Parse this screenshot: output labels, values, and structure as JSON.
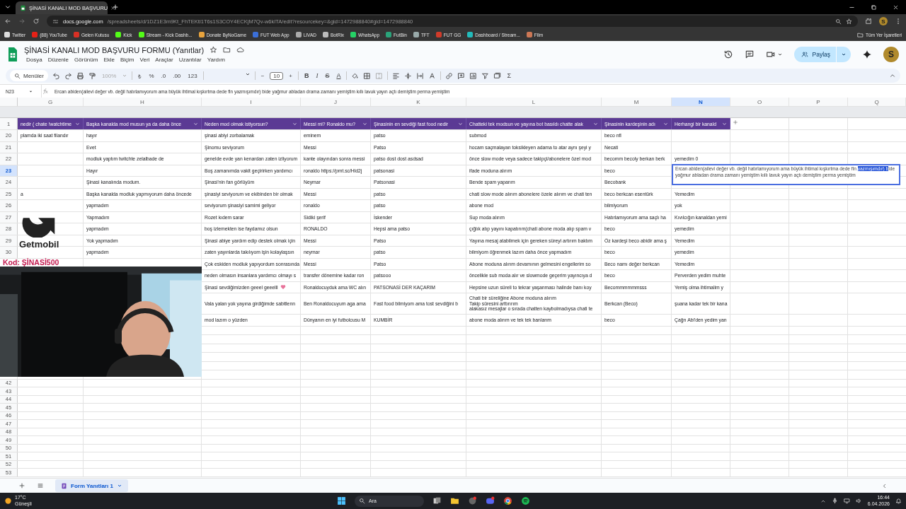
{
  "browser": {
    "tabs": [
      {
        "title": "ŞİNASİ KANALI MOD BAŞVURU",
        "selected": true
      }
    ],
    "url_domain": "docs.google.com",
    "url_path": "/spreadsheets/d/1DZ1E3m9Kt_FhTEKtI1T6s1S3COY4ECKjM7Qv-w6kITA/edit?resourcekey=&gid=1472988840#gid=1472988840",
    "bookmarks": [
      "Twitter",
      "(88) YouTube",
      "Gelen Kutusu",
      "Kick",
      "Stream - Kick Dashb...",
      "Donate ByNoGame",
      "FUT Web App",
      "LIVAD",
      "BotRix",
      "WhatsApp",
      "FutBin",
      "TFT",
      "FUT GG",
      "Dashboard / Stream...",
      "Film"
    ],
    "all_bookmarks": "Tüm Yer İşaretleri",
    "profile_avatar": "S"
  },
  "sheets": {
    "title": "ŞİNASİ KANALI MOD BAŞVURU FORMU (Yanıtlar)",
    "menu": [
      "Dosya",
      "Düzenle",
      "Görünüm",
      "Ekle",
      "Biçim",
      "Veri",
      "Araçlar",
      "Uzantılar",
      "Yardım"
    ],
    "share": "Paylaş",
    "avatar": "S",
    "toolbar": {
      "search": "Menüler",
      "zoom": "100%",
      "zoom_disabled": true,
      "currency": "₺",
      "percent": "%",
      "dec_less": ".0",
      "dec_more": ".00",
      "format": "123",
      "font_minus": "−",
      "font_size": "10",
      "font_plus": "+",
      "bold": "B",
      "italic": "I",
      "strike": "S",
      "text_color": "A",
      "sum": "Σ"
    },
    "name_box": "N23",
    "formula": "Ercan abiden(ailevi değer vb. değil hatırlamıyorum ama büyük ihtimal kışkırtma dede fln yazmışımdır) bide yağmur abladan drama zamanı yemiştim kıllı lavuk yayın açtı demiştim perma yemiştim",
    "columns": [
      {
        "letter": "G",
        "selected": false
      },
      {
        "letter": "H",
        "selected": false
      },
      {
        "letter": "I",
        "selected": false
      },
      {
        "letter": "J",
        "selected": false
      },
      {
        "letter": "K",
        "selected": false
      },
      {
        "letter": "L",
        "selected": false
      },
      {
        "letter": "M",
        "selected": false
      },
      {
        "letter": "N",
        "selected": true
      },
      {
        "letter": "O",
        "selected": false
      },
      {
        "letter": "P",
        "selected": false
      },
      {
        "letter": "Q",
        "selected": false
      }
    ],
    "header_row": {
      "number": "1",
      "cells": [
        "nedir ( chate !watchtime",
        "Başka kanalda mod musun ya da daha önce",
        "Neden mod olmak istiyorsun?",
        "Messi mi? Ronaldo mu?",
        "Şinasinin en sevdiği fast food nedir",
        "Chatteki tek modsun ve yayına bot basıldı chatte alak",
        "Şinasinin kardeşinin adı",
        "Herhangi bir kanald"
      ]
    },
    "rows": [
      {
        "number": "20",
        "selected": false,
        "G": "plamda iki saat filandır",
        "H": "hayır",
        "I": "şinasi abiyi zorbalamak",
        "J": "eminem",
        "K": "patso",
        "L": "submod",
        "M": "beco nfl"
      },
      {
        "number": "21",
        "selected": false,
        "H": "Evet",
        "I": "Şinomu seviyorum",
        "J": "Messi",
        "K": "Patso",
        "L": "hocam saçmalayan toksikleyen adama to atar aynı şeyi y",
        "M": "Necati"
      },
      {
        "number": "22",
        "selected": false,
        "H": "modluk yaptım twitchte zelalbade de",
        "I": "genelde evde yan kenardan zaten izliyorum",
        "J": "kante olayından sonra messi",
        "K": "patso dost dost asdsad",
        "L": "önce slow mode veya sadece takipçi/abonelere özel mod",
        "M": "becomm becoly berkan berk",
        "N": "yemedim 0"
      },
      {
        "number": "23",
        "selected": true,
        "H": "Hayır",
        "I": "Boş zamanımda vakit geçirirken yardımcı",
        "J": "ronaldo https://pmt.sc/Hld2j",
        "K": "patsonasi",
        "L": "ifade moduna alırım",
        "M": "beco"
      },
      {
        "number": "24",
        "selected": false,
        "H": "Şinasi kanalında modum.",
        "I": "Şinasi'nin fan görlüyüm",
        "J": "Neymar",
        "K": "Patsonasi",
        "L": "Bende spam yaparım",
        "M": "Becobank"
      },
      {
        "number": "25",
        "selected": false,
        "G": "a",
        "H": "Başka kanalda modluk yapmıyorum daha öncede",
        "I": "şinasiyi seviyorum ve ekibinden bir olmak",
        "J": "Messi",
        "K": "patso",
        "L": "chati slow mode alırım abonelere özele alırım ve chati ten",
        "M": "beco berkcan esentürk",
        "N": "Yemedim"
      },
      {
        "number": "26",
        "selected": false,
        "H": "yapmadım",
        "I": "seviyorum şinasiyi samimi geliyor",
        "J": "ronaldo",
        "K": "patso",
        "L": "abone mod",
        "M": "bilmiyorum",
        "N": "yok"
      },
      {
        "number": "27",
        "selected": false,
        "H": "Yapmadım",
        "I": "Rozet kıdem sarar",
        "J": "Sidiki şerif",
        "K": "İskender",
        "L": "Sup moda alırım",
        "M": "Hatırlamıyorum ama saçlı ha",
        "N": "Kıvılcığın kanaldan yemi"
      },
      {
        "number": "28",
        "selected": false,
        "H": "yapmadım",
        "I": "boş izlemekten ise faydamız olsun",
        "J": "RONALDO",
        "K": "Hepsi ama patso",
        "L": "çığlık atıp yayını kapatırım(chati abone moda alıp spam v",
        "M": "beco",
        "N": "yemedim"
      },
      {
        "number": "29",
        "selected": false,
        "H": "Yok yapmadım",
        "I": "Şinasi abiye yardım edip destek olmak için",
        "J": "Messi",
        "K": "Patso",
        "L": "Yayına mesaj atabilmek için gereken süreyi artırım baktım",
        "M": "Öz kardeşi beco abidir ama ş",
        "N": "Yemedim"
      },
      {
        "number": "30",
        "selected": false,
        "H": "yapmadım",
        "I": "zaten yayınlarda takılıyom işin kolaylaşsın",
        "J": "neymar",
        "K": "patso",
        "L": "bilmiyom öğrenmek lazım daha önce yapmadım",
        "M": "beco",
        "N": "yemedim"
      },
      {
        "selected": false,
        "I": "Çok eskiden modluk yapıyordum sonrasında",
        "J": "Messi",
        "K": "Patso",
        "L": "Abone moduna alırım devamının gelmesini engellerim so",
        "M": "Beco namı değer berkcan",
        "N": "Yemedim"
      },
      {
        "selected": false,
        "I": "neden olmasın insanlara yardımcı olmayı s",
        "J": "transfer dönemine kadar ron",
        "K": "patsooo",
        "L": "öncelikle sub moda alır ve slowmode geçerim yayıncıya d",
        "M": "beco",
        "N": "Perverden yedim muhte"
      },
      {
        "selected": false,
        "heart": true,
        "I": "Şinasi sevdiğimizden geeel geeelll",
        "J": "Ronaldocuyduk ama WC alın",
        "K": "PATSONASİ DER KAÇARIM",
        "L": "Hepsine uzun süreli to tekrar yaşanması halinde banı koy",
        "M": "Becommmmmmsss",
        "N": "Yemiş olma ihtimalim y"
      },
      {
        "selected": false,
        "tall": true,
        "I": "Vala yalan yok yayına girdiğimde sabitlenn",
        "J": "Ben Ronaldocuyum aga ama",
        "K": "Fast food bilmiyom ama tost sevdiğini b",
        "L": "Chati bir süreliğine Abone moduna alırım\nTakip süresini arttırırım\nalakasız mesajlar o sırada chatten kaybolmadıysa chati te",
        "M": "Berkcan (Beco)",
        "N": "şuana kadar tek bir kana"
      },
      {
        "selected": false,
        "I": "mod lazım o yüzden",
        "J": "Dünyanın en iyi futbolcusu M",
        "K": "KUMBİR",
        "L": "abone moda alırım ve tek tek banlarım",
        "M": "beco",
        "N": "Çağrı Abi'den yedim yan"
      }
    ],
    "editor": {
      "before": "Ercan abiden(ailevi değer vb. değil hatırlamıyorum ama büyük ihtimal kışkırtma dede fln ",
      "highlighted": "yazmışımdır) b",
      "after": "ide yağmur abladan drama zamanı yemiştim kıllı lavuk yayın açtı demiştim perma yemiştim"
    },
    "lower_rows": [
      "42",
      "43",
      "44",
      "45",
      "46",
      "47",
      "48",
      "49",
      "50",
      "51",
      "52",
      "53"
    ],
    "sheet_tabs": [
      {
        "label": "Form Yanıtları 1",
        "selected": true
      }
    ]
  },
  "overlay": {
    "brand": "Getmobil",
    "code": "Kod: ŞİNASİ500"
  },
  "taskbar": {
    "temperature": "17°C",
    "weather": "Güneşli",
    "search": "Ara",
    "time": "16:44",
    "date": "6.04.2026"
  }
}
